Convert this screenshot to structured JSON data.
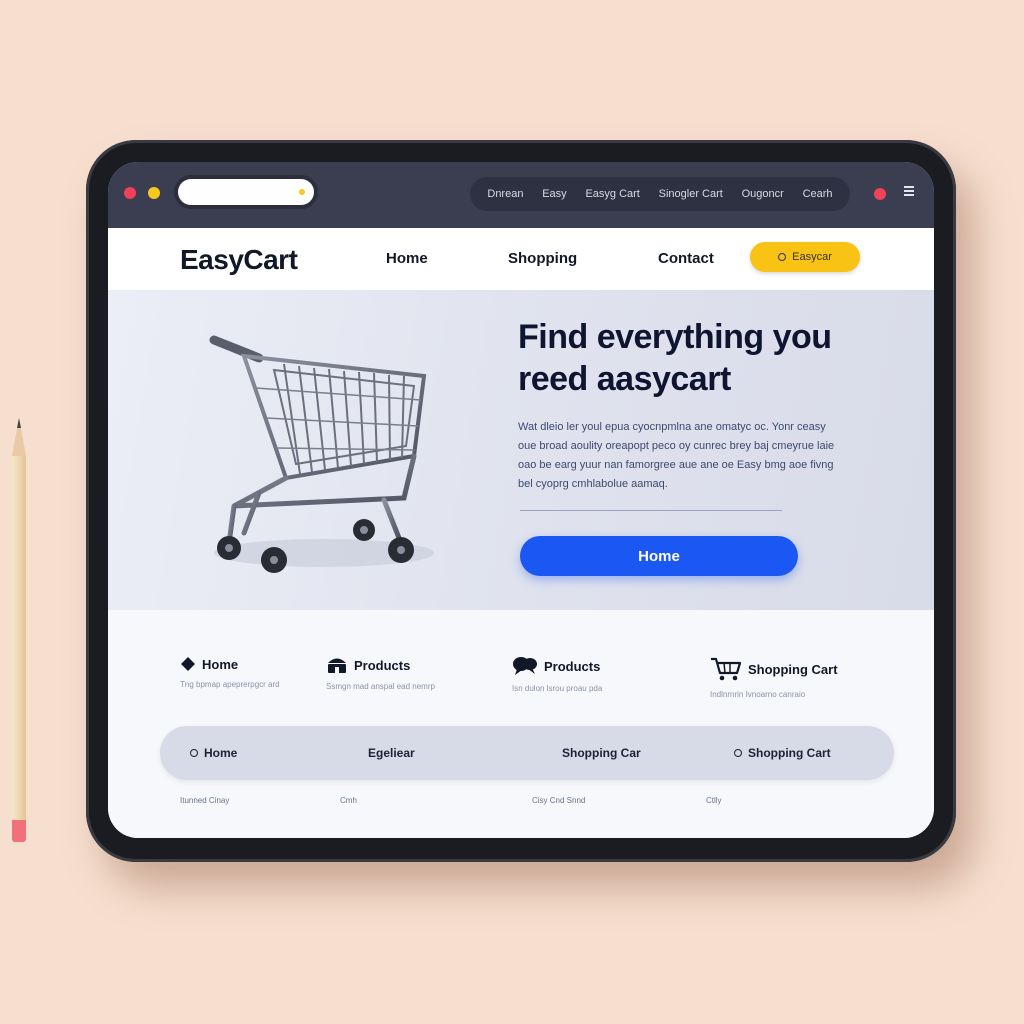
{
  "browser": {
    "nav": [
      "Dnrean",
      "Easy",
      "Easyg Cart",
      "Sinogler Cart",
      "Ougoncr",
      "Cearh"
    ]
  },
  "site": {
    "logo": "EasyCart",
    "nav": {
      "home": "Home",
      "shopping": "Shopping",
      "contact": "Contact"
    },
    "cta_label": "Easycar"
  },
  "hero": {
    "title": "Find everything you reed aasycart",
    "body": "Wat dleio ler youl epua cyocnpmlna ane omatyc oc. Yonr ceasy oue broad aoulity oreapopt peco oy cunrec brey baj cmeyrue laie oao be earg yuur nan famorgree aue ane oe Easy bmg aoe fivng bel cyoprg cmhlabolue aamaq.",
    "button": "Home"
  },
  "features": [
    {
      "label": "Home",
      "icon": "diamond-icon",
      "sub": "Tng bpmap apeprerpgcr ard"
    },
    {
      "label": "Products",
      "icon": "store-icon",
      "sub": "Ssmgn mad anspal ead nemrp"
    },
    {
      "label": "Products",
      "icon": "chat-bubbles-icon",
      "sub": "Isn dulon lsrou proau pda"
    },
    {
      "label": "Shopping Cart",
      "icon": "shopping-cart-icon",
      "sub": "Indlnrnrin Ivnoarno canraio"
    }
  ],
  "pill_bar": {
    "items": [
      "Home",
      "Egeliear",
      "Shopping Car",
      "Shopping Cart"
    ]
  },
  "footer": [
    "Itunned Cinay",
    "Cmh",
    "Cisy Cnd Snnd",
    "Ctlly"
  ],
  "colors": {
    "brand_yellow": "#f8c315",
    "primary_blue": "#1b57f2",
    "chrome_dark": "#3b3e50"
  }
}
